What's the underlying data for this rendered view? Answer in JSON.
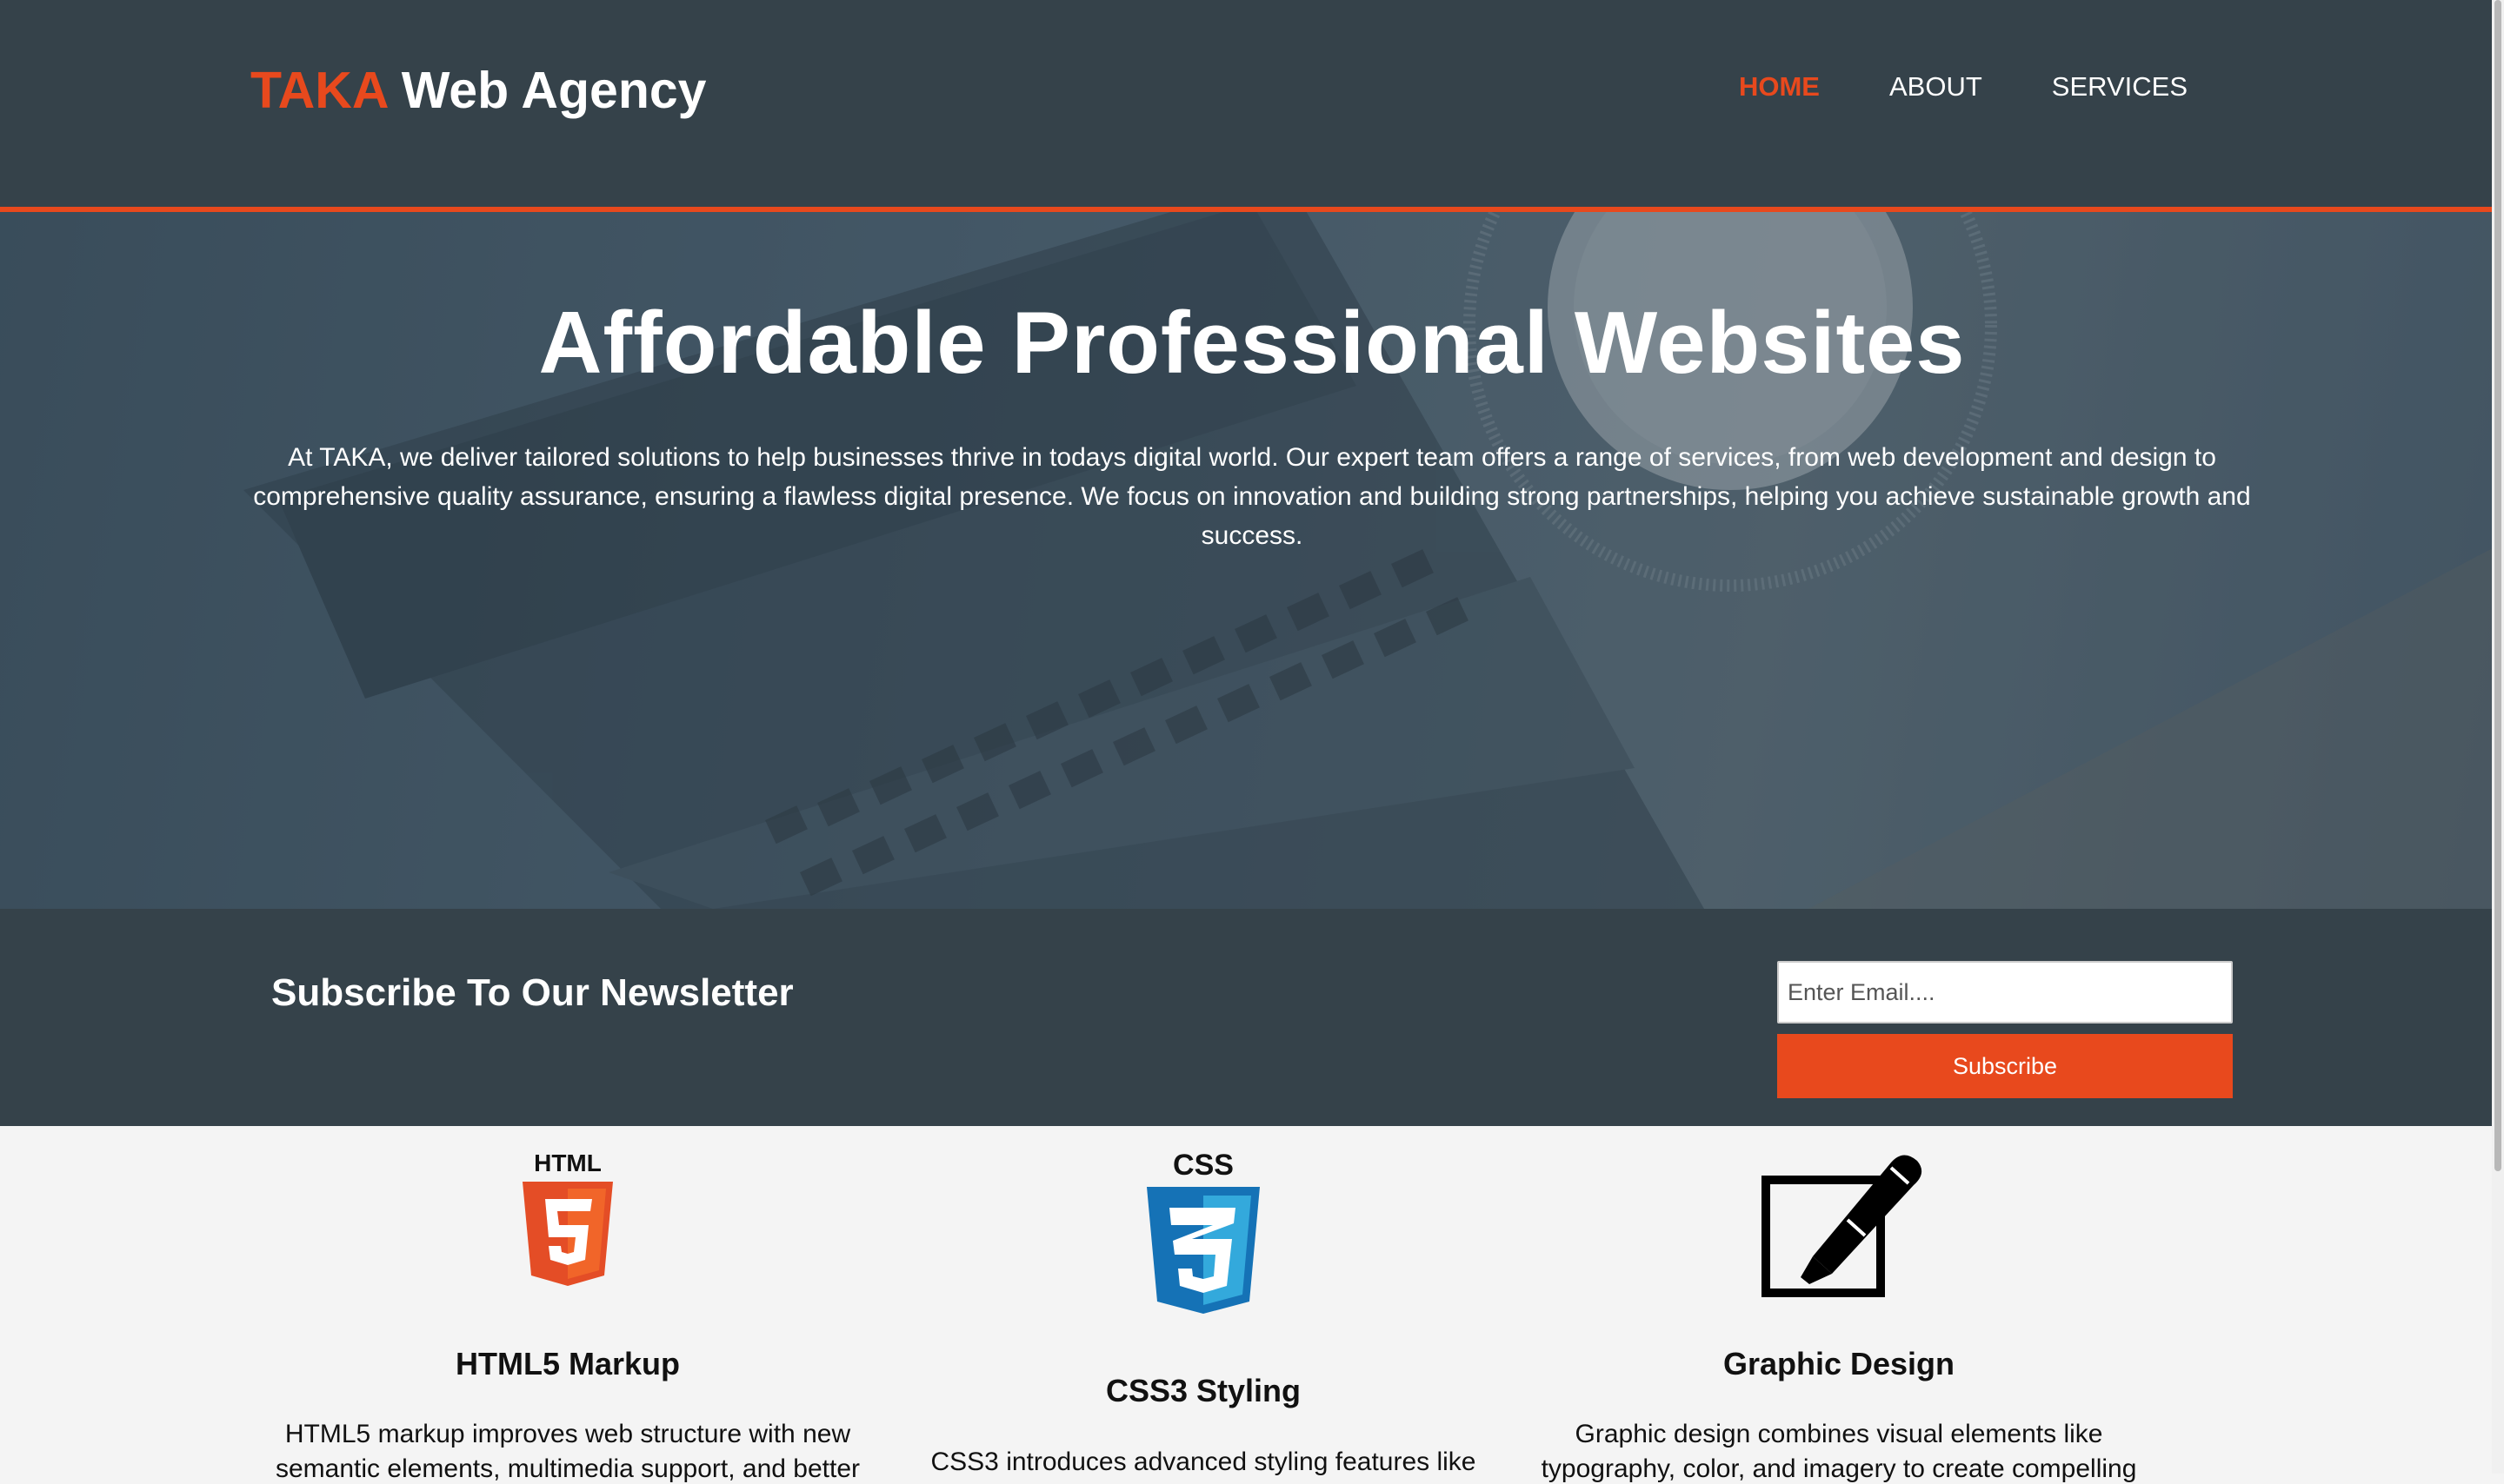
{
  "header": {
    "logo_highlight": "TAKA",
    "logo_rest": " Web Agency",
    "nav": [
      "HOME",
      "ABOUT",
      "SERVICES"
    ]
  },
  "showcase": {
    "title": "Affordable Professional Websites",
    "text": "At TAKA, we deliver tailored solutions to help businesses thrive in todays digital world. Our expert team offers a range of services, from web development and design to comprehensive quality assurance, ensuring a flawless digital presence. We focus on innovation and building strong partnerships, helping you achieve sustainable growth and success."
  },
  "newsletter": {
    "title": "Subscribe To Our Newsletter",
    "email_placeholder": "Enter Email....",
    "email_value": "",
    "button_label": "Subscribe"
  },
  "boxes": [
    {
      "icon": "html5-icon",
      "icon_label": "HTML",
      "title": "HTML5 Markup",
      "text_line1": "HTML5 markup improves web structure with new",
      "text_line2": "semantic elements, multimedia support, and better"
    },
    {
      "icon": "css3-icon",
      "icon_label": "CSS",
      "title": "CSS3 Styling",
      "text_line1": "CSS3 introduces advanced styling features like",
      "text_line2": ""
    },
    {
      "icon": "graphic-design-icon",
      "icon_label": "",
      "title": "Graphic Design",
      "text_line1": "Graphic design combines visual elements like",
      "text_line2": "typography, color, and imagery to create compelling"
    }
  ],
  "colors": {
    "accent": "#e8491d",
    "dark": "#35424a",
    "light_bg": "#f4f4f4",
    "html5_orange": "#e44d26",
    "css3_blue": "#1572b6"
  }
}
